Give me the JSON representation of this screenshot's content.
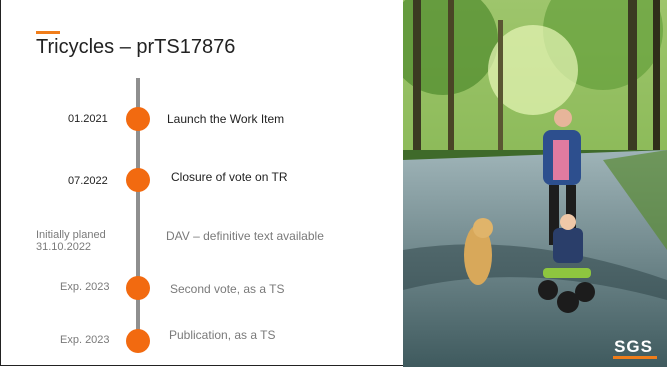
{
  "title": "Tricycles – prTS17876",
  "timeline": [
    {
      "date": "01.2021",
      "label": "Launch the Work Item"
    },
    {
      "date": "07.2022",
      "label": "Closure of vote on TR"
    },
    {
      "date_line1": "Initially planed",
      "date_line2": "31.10.2022",
      "label": "DAV – definitive text available"
    },
    {
      "date": "Exp. 2023",
      "label": "Second vote, as a TS"
    },
    {
      "date": "Exp. 2023",
      "label": "Publication, as a TS"
    }
  ],
  "logo": "SGS",
  "colors": {
    "accent": "#f07d1a",
    "dot": "#f26a10",
    "line": "#8f8f8f"
  }
}
